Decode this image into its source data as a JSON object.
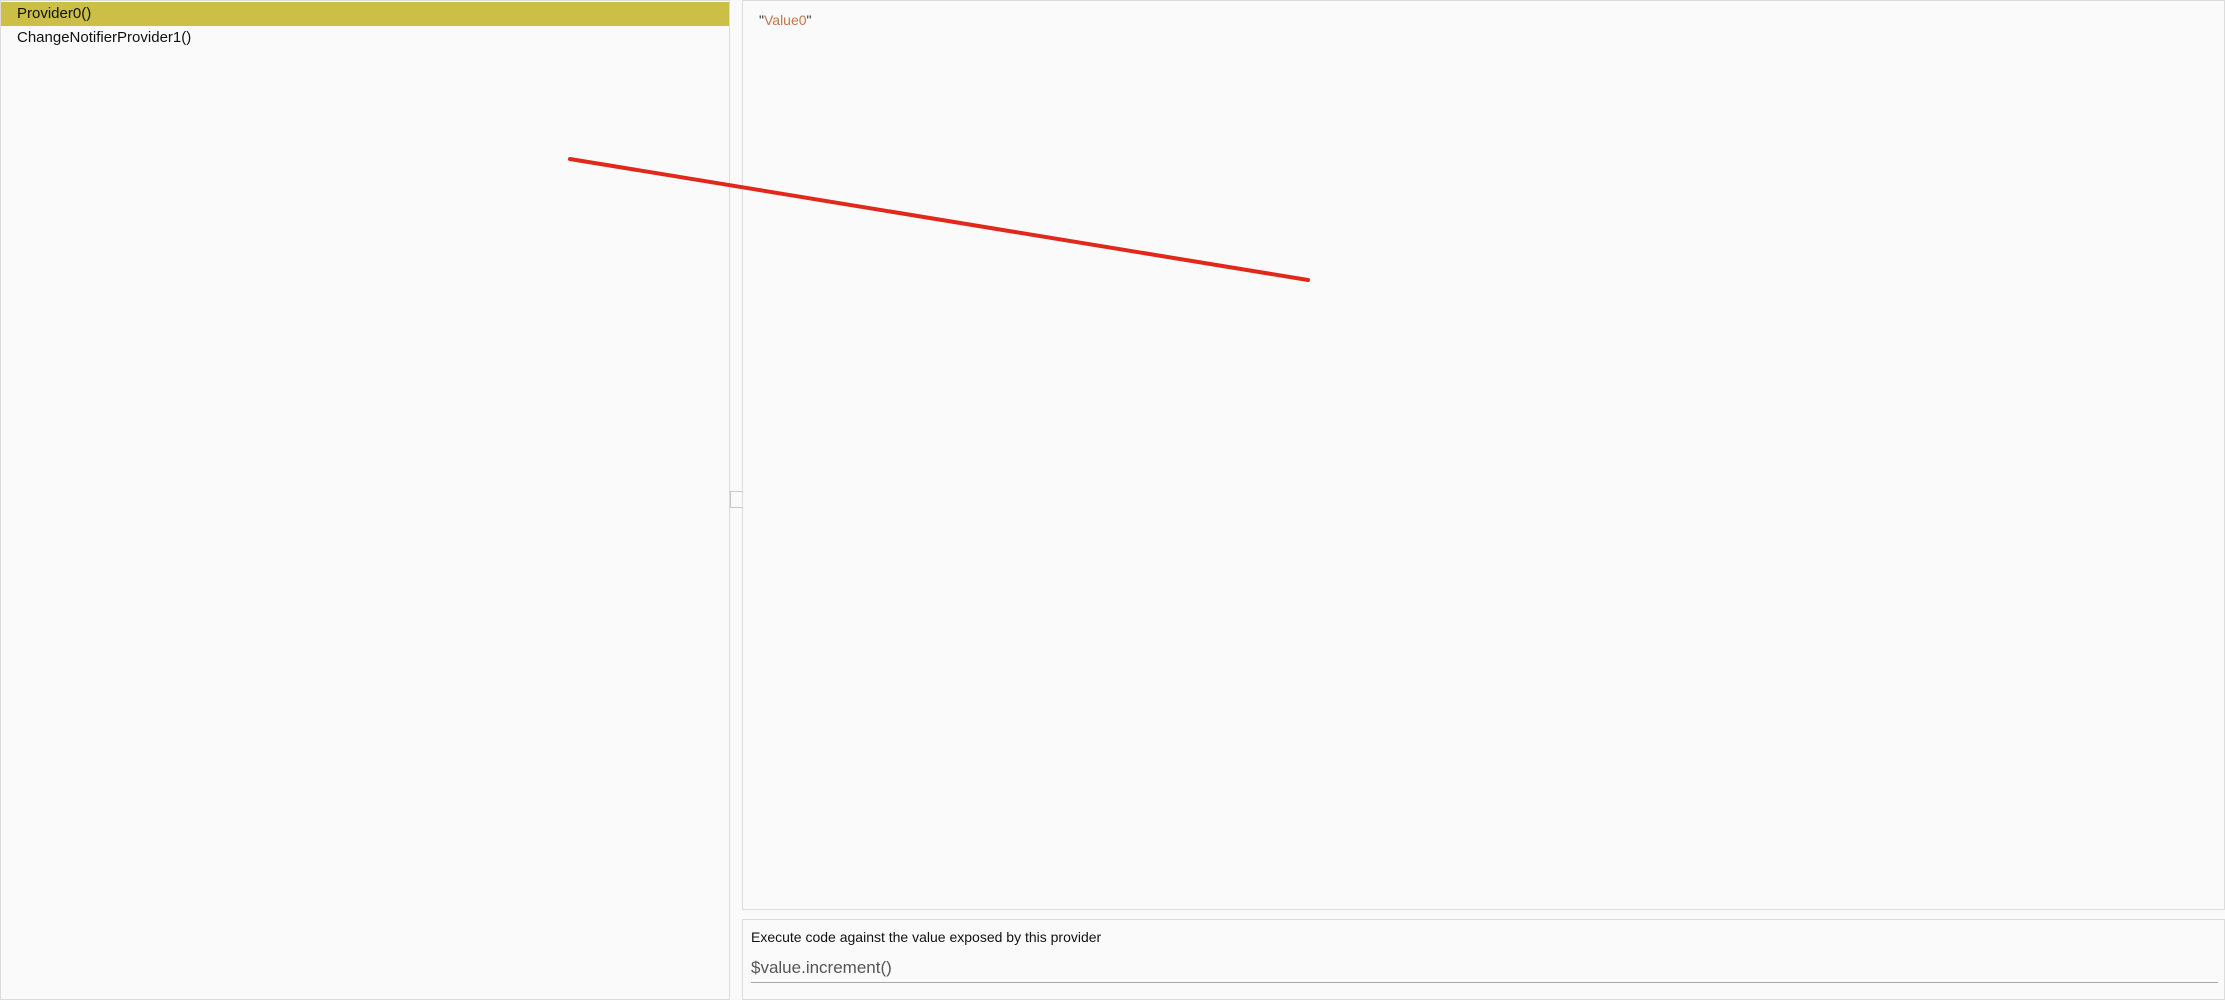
{
  "providers": {
    "items": [
      {
        "label": "Provider0()",
        "selected": true
      },
      {
        "label": "ChangeNotifierProvider1()",
        "selected": false
      }
    ]
  },
  "value_panel": {
    "quote_open": "\"",
    "value": "Value0",
    "quote_close": "\""
  },
  "eval": {
    "label": "Execute code against the value exposed by this provider",
    "placeholder": "$value.increment()"
  },
  "colors": {
    "selection": "#cbbf47",
    "string_value": "#c4744f",
    "annotation_stroke": "#e0281b"
  }
}
